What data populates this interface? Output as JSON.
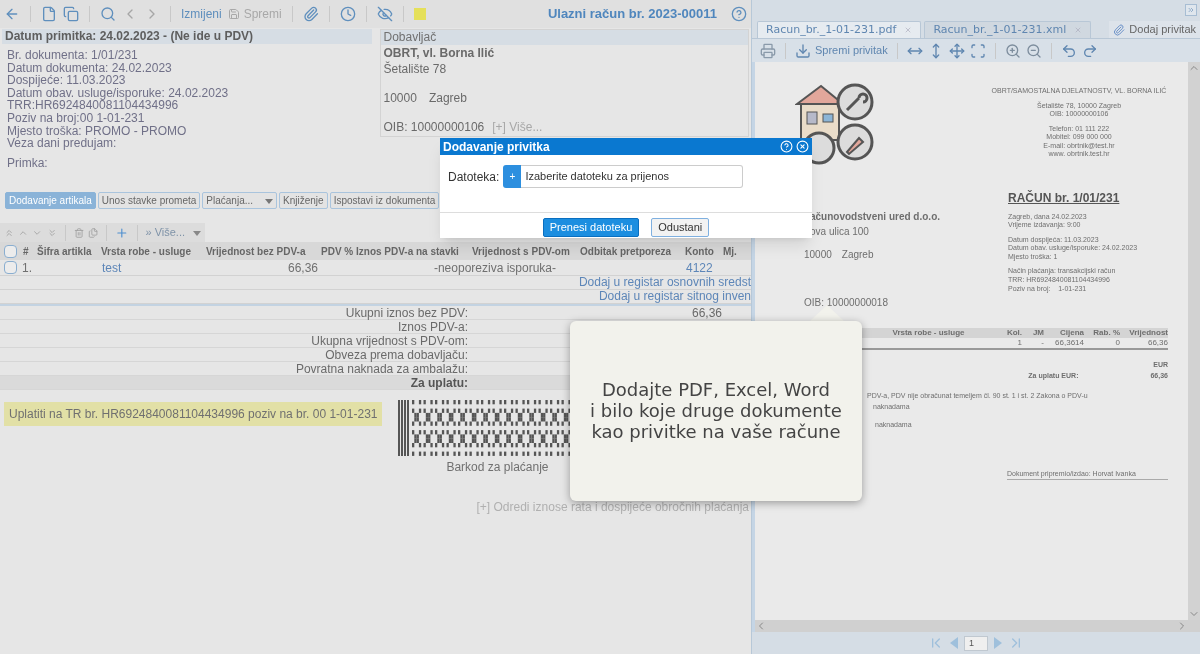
{
  "toolbar": {
    "edit": "Izmijeni",
    "save": {
      "label": "Spremi",
      "disabled": true
    },
    "title": "Ulazni račun br. 2023-00011"
  },
  "receipt": {
    "heading": "Datum primitka: 24.02.2023 - (Ne ide u PDV)",
    "lines": [
      "Br. dokumenta: 1/01/231",
      "Datum dokumenta: 24.02.2023",
      "Dospijeće: 11.03.2023",
      "Datum obav. usluge/isporuke: 24.02.2023",
      "TRR:HR6924840081104434996",
      "Poziv na broj:00 1-01-231",
      "Mjesto troška: PROMO - PROMO",
      "Veza dani predujam:"
    ]
  },
  "supplier": {
    "heading": "Dobavljač",
    "name": "OBRT, vl. Borna Ilić",
    "street": "Šetalište 78",
    "postal_code": "10000",
    "city": "Zagreb",
    "oib": "OIB: 10000000106",
    "more": "[+] Više..."
  },
  "primka": "Primka:",
  "tabs": [
    {
      "label": "Dodavanje artikala",
      "selected": true,
      "kind": "button"
    },
    {
      "label": "Unos stavke prometa",
      "selected": false,
      "kind": "button"
    },
    {
      "label": "Plaćanja...",
      "selected": false,
      "kind": "dropdown"
    },
    {
      "label": "Knjiženje",
      "selected": false,
      "kind": "button"
    },
    {
      "label": "Ispostavi iz dokumenta",
      "selected": false,
      "kind": "button"
    }
  ],
  "item_toolbar": {
    "more": "» Više..."
  },
  "table": {
    "columns": [
      "#",
      "Šifra artikla",
      "Vrsta robe - usluge",
      "Vrijednost bez PDV-a",
      "PDV %",
      "Iznos PDV-a na stavki",
      "Vrijednost s PDV-om",
      "Odbitak pretporeza",
      "Konto",
      "Mj."
    ],
    "header_checked": false,
    "rows": [
      {
        "checked": false,
        "number": "1.",
        "item": "test",
        "net_value": "66,36",
        "vat_note": "-neoporeziva isporuka-",
        "account": "4122"
      }
    ]
  },
  "register_links": [
    "Dodaj u registar osnovnih sredst",
    "Dodaj u registar sitnog inven"
  ],
  "totals": [
    {
      "label": "Ukupni iznos bez PDV:",
      "value": "66,36",
      "kind": "line"
    },
    {
      "label": "Iznos PDV-a:",
      "kind": "line"
    },
    {
      "label": "Ukupna vrijednost s PDV-om:",
      "kind": "line"
    },
    {
      "label": "Obveza prema dobavljaču:",
      "kind": "line"
    },
    {
      "label": "Povratna naknada za ambalažu:",
      "kind": "line"
    },
    {
      "label": "Za uplatu:",
      "kind": "total"
    }
  ],
  "payment_note": "Uplatiti na TR br. HR6924840081104434996 poziv na br. 00 1-01-231",
  "barcode_caption": "Barkod za plaćanje",
  "installments_link": "[+] Odredi iznose rata i dospijeće obročnih plaćanja",
  "viewer": {
    "tabs": [
      {
        "label": "Racun_br._1-01-231.pdf",
        "selected": true
      },
      {
        "label": "Racun_br._1-01-231.xml",
        "selected": false
      }
    ],
    "add_attachment": "Dodaj privitak",
    "save_attachment": "Spremi privitak",
    "page": "1",
    "document": {
      "issuer_groups": [
        [
          "OBRT/SAMOSTALNA DJELATNOSTV, VL. BORNA ILIĆ"
        ],
        [
          "Šetalište 78, 10000 Zagreb",
          "OIB: 10000000106"
        ],
        [
          "Telefon: 01 111 222",
          "Mobitel: 099 000 000",
          "E-mail: obrtnik@test.hr",
          "www. obrtnik.test.hr"
        ]
      ],
      "buyer": {
        "name": "ačunovodstveni ured d.o.o.",
        "street": "ova ulica 100",
        "postal_code": "10000",
        "city": "Zagreb",
        "oib": "OIB: 10000000018"
      },
      "invoice_title": "RAČUN br. 1/01/231",
      "invoice_groups": [
        [
          "Zagreb, dana 24.02.2023",
          "Vrijeme izdavanja: 9:00"
        ],
        [
          "Datum dospijeća: 11.03.2023",
          "Datum obav. usluge/isporuke: 24.02.2023",
          "Mjesto troška: 1"
        ],
        [
          "Način plaćanja: transakcijski račun",
          "TRR: HR6924840081104434996",
          "Poziv na broj:    1-01-231"
        ]
      ],
      "table_columns": [
        "Vrsta robe - usluge",
        "Kol.",
        "JM",
        "Cijena",
        "Rab. %",
        "Vrijednost"
      ],
      "table_row": [
        "1",
        "-",
        "66,3614",
        "0",
        "66,36"
      ],
      "currency": "EUR",
      "total_label": "Za uplatu EUR:",
      "total_value": "66,36",
      "notes": [
        "PDV-a, PDV nije obračunat temeljem čl. 90 st. 1 i st. 2 Zakona o PDV-u",
        "naknadama",
        "naknadama"
      ],
      "signature": "Dokument pripremio/izdao: Horvat Ivanka"
    }
  },
  "dialog": {
    "title": "Dodavanje privitka",
    "field_label": "Datoteka:",
    "field_button": "+",
    "placeholder": "Izaberite datoteku za prijenos",
    "buttons": [
      {
        "label": "Prenesi datoteku",
        "kind": "primary"
      },
      {
        "label": "Odustani",
        "kind": "secondary"
      }
    ]
  },
  "callout": {
    "lines": [
      "Dodajte PDF, Excel, Word",
      "i bilo koje druge dokumente",
      "kao privitke na vaše račune"
    ]
  }
}
